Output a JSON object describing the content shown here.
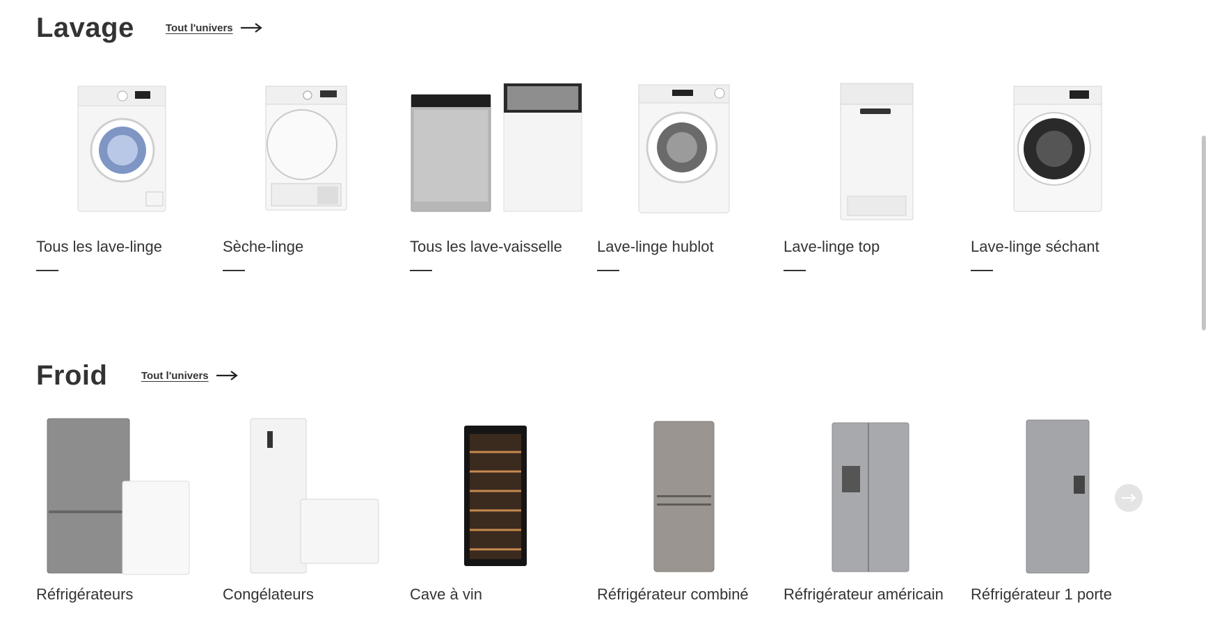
{
  "sections": [
    {
      "title": "Lavage",
      "link_label": "Tout l'univers",
      "items": [
        {
          "label": "Tous les lave-linge",
          "image": "front-load-washer-blue-drum"
        },
        {
          "label": "Sèche-linge",
          "image": "tumble-dryer"
        },
        {
          "label": "Tous les lave-vaisselle",
          "image": "dishwashers-pair"
        },
        {
          "label": "Lave-linge hublot",
          "image": "front-load-washer-grey-drum"
        },
        {
          "label": "Lave-linge top",
          "image": "top-load-washer"
        },
        {
          "label": "Lave-linge séchant",
          "image": "washer-dryer-dark-door"
        }
      ]
    },
    {
      "title": "Froid",
      "link_label": "Tout l'univers",
      "items": [
        {
          "label": "Réfrigérateurs",
          "image": "fridge-combo-and-table-fridge"
        },
        {
          "label": "Congélateurs",
          "image": "upright-and-chest-freezer"
        },
        {
          "label": "Cave à vin",
          "image": "wine-cellar"
        },
        {
          "label": "Réfrigérateur combiné",
          "image": "combi-fridge-inox"
        },
        {
          "label": "Réfrigérateur américain",
          "image": "american-fridge"
        },
        {
          "label": "Réfrigérateur 1 porte",
          "image": "single-door-fridge-silver"
        }
      ]
    }
  ],
  "icons": {
    "link_arrow": "arrow-right-icon",
    "carousel_next": "arrow-right-icon"
  },
  "colors": {
    "text": "#333333",
    "background": "#ffffff",
    "next_button": "#e4e4e4"
  }
}
